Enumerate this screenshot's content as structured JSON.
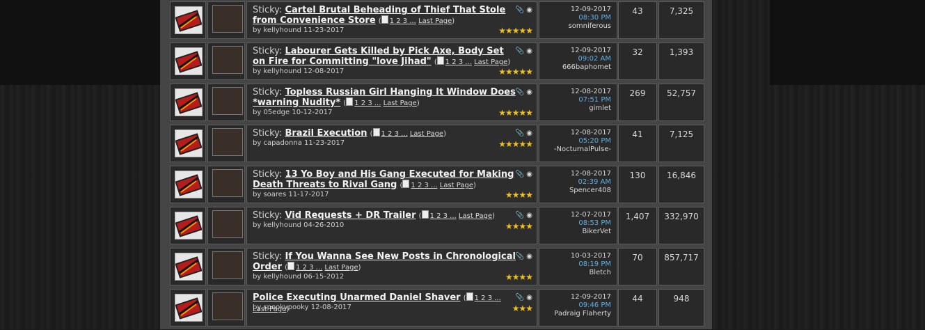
{
  "rows": [
    {
      "sticky": "Sticky:",
      "title": "Cartel Brutal Beheading of Thief That Stole from Convenience Store",
      "pages": "1 2 3 ...",
      "last_page": "Last Page",
      "byline": "by kellyhound 11-23-2017",
      "stars": "★★★★★",
      "last_date": "12-09-2017",
      "last_time": "08:30 PM",
      "last_user": "somniferous",
      "replies": "43",
      "views": "7,325"
    },
    {
      "sticky": "Sticky:",
      "title": "Labourer Gets Killed by Pick Axe, Body Set on Fire for Committing \"love Jihad\"",
      "pages": "1 2 3 ...",
      "last_page": "Last Page",
      "byline": "by kellyhound 12-08-2017",
      "stars": "★★★★★",
      "last_date": "12-09-2017",
      "last_time": "09:02 AM",
      "last_user": "666baphomet",
      "replies": "32",
      "views": "1,393"
    },
    {
      "sticky": "Sticky:",
      "title": "Topless Russian Girl Hanging It Window Does *warning Nudity*",
      "pages": "1 2 3 ...",
      "last_page": "Last Page",
      "byline": "by 05edge 10-12-2017",
      "stars": "★★★★★",
      "last_date": "12-08-2017",
      "last_time": "07:51 PM",
      "last_user": "gimlet",
      "replies": "269",
      "views": "52,757"
    },
    {
      "sticky": "Sticky:",
      "title": "Brazil Execution",
      "pages": "1 2 3 ...",
      "last_page": "Last Page",
      "byline": "by capadonna 11-23-2017",
      "stars": "★★★★★",
      "last_date": "12-08-2017",
      "last_time": "05:20 PM",
      "last_user": "-NocturnalPulse-",
      "replies": "41",
      "views": "7,125"
    },
    {
      "sticky": "Sticky:",
      "title": "13 Yo Boy and His Gang Executed for Making Death Threats to Rival Gang",
      "pages": "1 2 3 ...",
      "last_page": "Last Page",
      "byline": "by soares 11-17-2017",
      "stars": "★★★★",
      "last_date": "12-08-2017",
      "last_time": "02:39 AM",
      "last_user": "Spencer408",
      "replies": "130",
      "views": "16,846"
    },
    {
      "sticky": "Sticky:",
      "title": "Vid Requests + DR Trailer",
      "pages": "1 2 3 ...",
      "last_page": "Last Page",
      "byline": "by kellyhound 04-26-2010",
      "stars": "★★★★",
      "last_date": "12-07-2017",
      "last_time": "08:53 PM",
      "last_user": "BikerVet",
      "replies": "1,407",
      "views": "332,970"
    },
    {
      "sticky": "Sticky:",
      "title": "If You Wanna See New Posts in Chronological Order",
      "pages": "1 2 3 ...",
      "last_page": "Last Page",
      "byline": "by kellyhound 06-15-2012",
      "stars": "★★★★",
      "last_date": "10-03-2017",
      "last_time": "08:19 PM",
      "last_user": "Bletch",
      "replies": "70",
      "views": "857,717"
    },
    {
      "sticky": "",
      "title": "Police Executing Unarmed Daniel Shaver",
      "pages": "1 2 3 ...",
      "last_page": "Last Page",
      "byline": "by spookypooky 12-08-2017",
      "stars": "★★★",
      "last_date": "12-09-2017",
      "last_time": "09:46 PM",
      "last_user": "Padraig Flaherty",
      "replies": "44",
      "views": "948"
    }
  ]
}
